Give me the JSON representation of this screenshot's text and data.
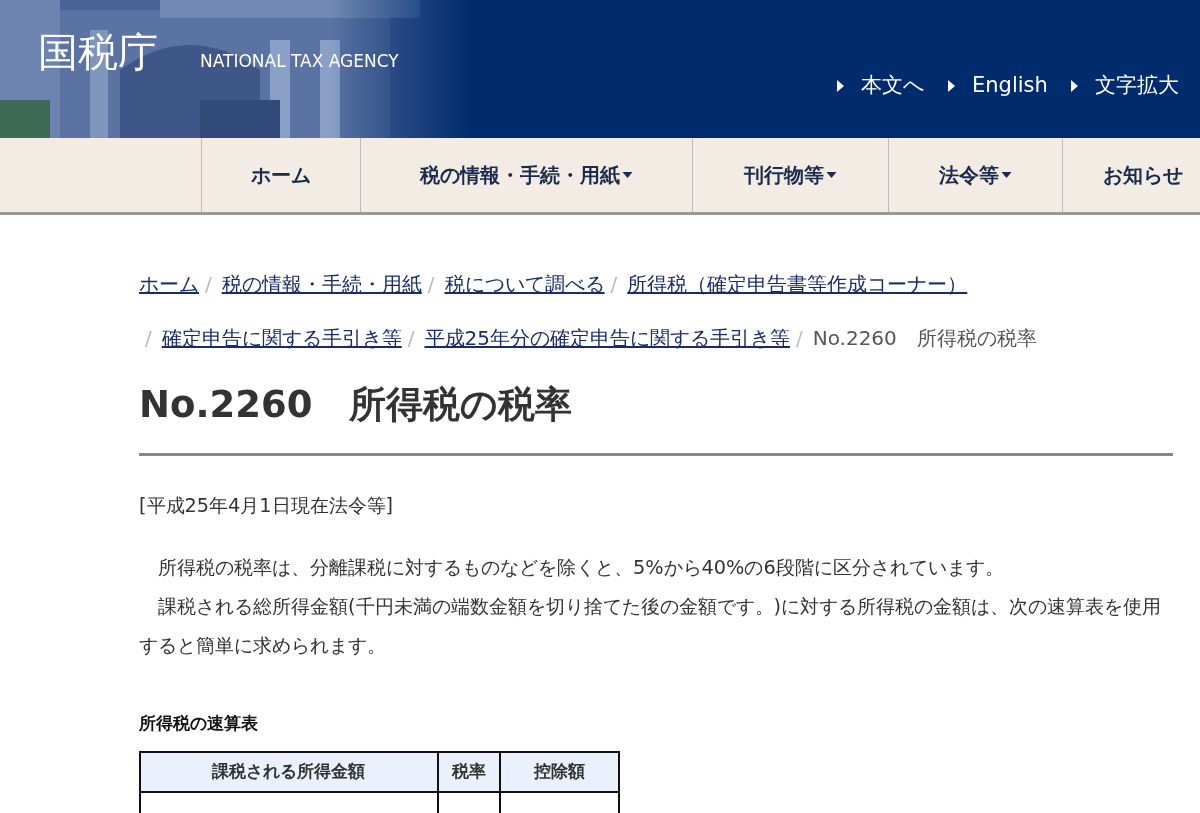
{
  "header": {
    "logo": "国税庁",
    "subtitle": "NATIONAL TAX AGENCY",
    "links": [
      "本文へ",
      "English",
      "文字拡大"
    ]
  },
  "nav": [
    {
      "label": "ホーム",
      "dropdown": false
    },
    {
      "label": "税の情報・手続・用紙",
      "dropdown": true
    },
    {
      "label": "刊行物等",
      "dropdown": true
    },
    {
      "label": "法令等",
      "dropdown": true
    },
    {
      "label": "お知らせ",
      "dropdown": false
    }
  ],
  "breadcrumb_separator": "/",
  "breadcrumb": [
    {
      "label": "ホーム",
      "link": true
    },
    {
      "label": "税の情報・手続・用紙",
      "link": true
    },
    {
      "label": "税について調べる",
      "link": true
    },
    {
      "label": "所得税（確定申告書等作成コーナー）",
      "link": true
    },
    {
      "label": "確定申告に関する手引き等",
      "link": true
    },
    {
      "label": "平成25年分の確定申告に関する手引き等",
      "link": true
    },
    {
      "label": "No.2260　所得税の税率",
      "link": false
    }
  ],
  "title": "No.2260　所得税の税率",
  "date_note": "[平成25年4月1日現在法令等]",
  "paragraphs": [
    "　所得税の税率は、分離課税に対するものなどを除くと、5%から40%の6段階に区分されています。",
    "　課税される総所得金額(千円未満の端数金額を切り捨てた後の金額です。)に対する所得税の金額は、次の速算表を使用すると簡単に求められます。"
  ],
  "table": {
    "caption": "所得税の速算表",
    "columns": [
      "課税される所得金額",
      "税率",
      "控除額"
    ]
  }
}
